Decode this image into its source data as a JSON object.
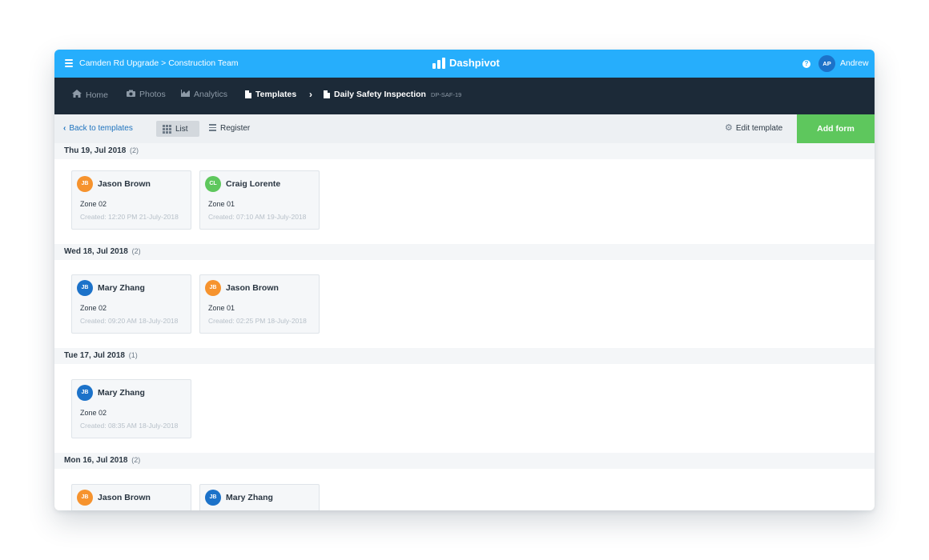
{
  "colors": {
    "topbar": "#26aefc",
    "navbar": "#1c2a38",
    "add_form": "#5ec75d",
    "avatar_orange": "#f6932e",
    "avatar_green": "#5ec75d",
    "avatar_blue": "#1c72c9"
  },
  "topbar": {
    "breadcrumb": "Camden Rd Upgrade > Construction Team",
    "brand": "Dashpivot",
    "help": "?",
    "user_initials": "AP",
    "user_name": "Andrew"
  },
  "nav": {
    "home": "Home",
    "photos": "Photos",
    "analytics": "Analytics",
    "templates": "Templates",
    "current": "Daily Safety Inspection",
    "code": "DP-SAF-19"
  },
  "toolbar": {
    "back": "Back to templates",
    "list": "List",
    "register": "Register",
    "edit_template": "Edit template",
    "add_form": "Add form"
  },
  "groups": [
    {
      "date": "Thu 19, Jul 2018",
      "count": "(2)",
      "cards": [
        {
          "initials": "JB",
          "avatar_color": "orange",
          "name": "Jason Brown",
          "zone": "Zone 02",
          "created": "Created: 12:20 PM 21-July-2018"
        },
        {
          "initials": "CL",
          "avatar_color": "green",
          "name": "Craig Lorente",
          "zone": "Zone 01",
          "created": "Created: 07:10 AM 19-July-2018"
        }
      ]
    },
    {
      "date": "Wed 18, Jul 2018",
      "count": "(2)",
      "cards": [
        {
          "initials": "JB",
          "avatar_color": "blue",
          "name": "Mary Zhang",
          "zone": "Zone 02",
          "created": "Created: 09:20 AM 18-July-2018"
        },
        {
          "initials": "JB",
          "avatar_color": "orange",
          "name": "Jason Brown",
          "zone": "Zone 01",
          "created": "Created: 02:25 PM 18-July-2018"
        }
      ]
    },
    {
      "date": "Tue 17, Jul 2018",
      "count": "(1)",
      "cards": [
        {
          "initials": "JB",
          "avatar_color": "blue",
          "name": "Mary Zhang",
          "zone": "Zone 02",
          "created": "Created: 08:35 AM 18-July-2018"
        }
      ]
    },
    {
      "date": "Mon 16, Jul 2018",
      "count": "(2)",
      "cards": [
        {
          "initials": "JB",
          "avatar_color": "orange",
          "name": "Jason Brown",
          "zone": "",
          "created": ""
        },
        {
          "initials": "JB",
          "avatar_color": "blue",
          "name": "Mary Zhang",
          "zone": "",
          "created": ""
        }
      ]
    }
  ]
}
